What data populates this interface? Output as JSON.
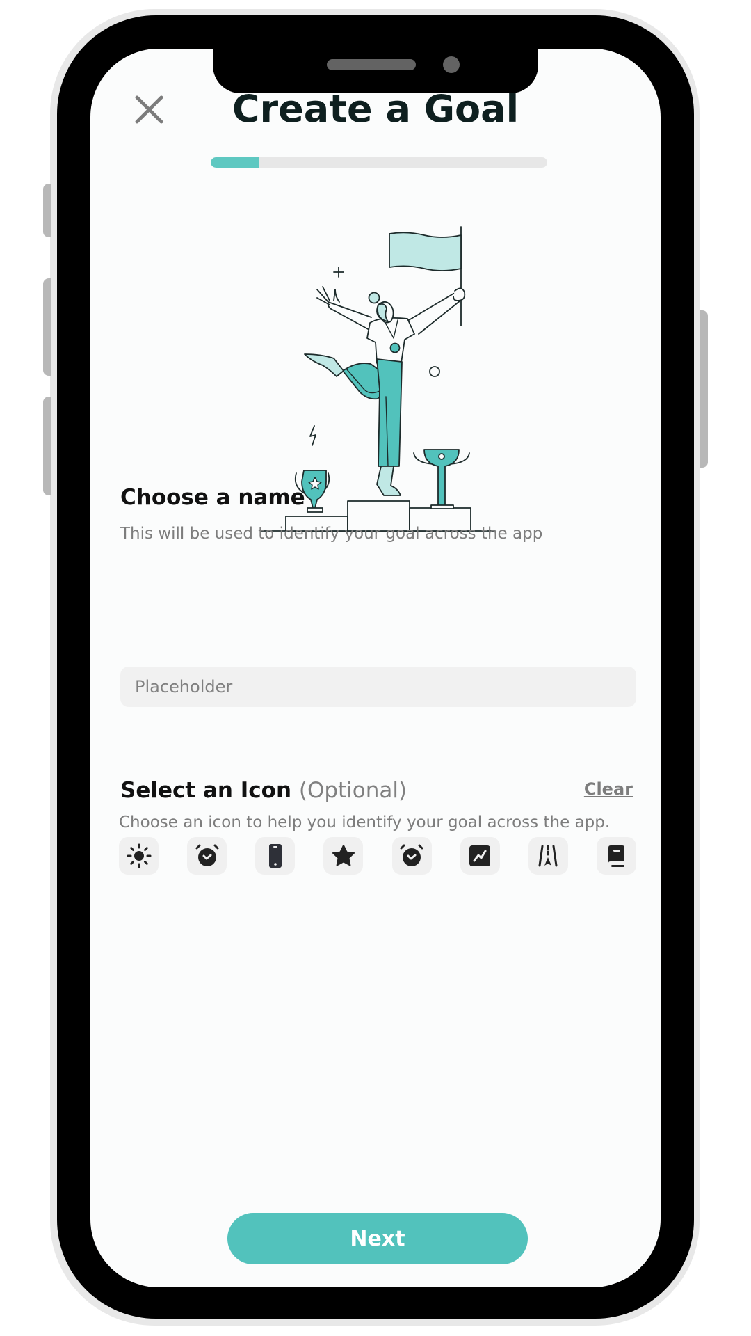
{
  "header": {
    "title": "Create a Goal",
    "close_icon": "close-icon",
    "progress": 0.145
  },
  "illustration": {
    "description": "woman-celebrating-on-podium-with-flag-and-trophies",
    "accent_color": "#52c2bc",
    "light_color": "#c0e8e5",
    "line_color": "#1d2b2b"
  },
  "name_section": {
    "title": "Choose a name",
    "subtitle": "This will be used to identify your goal across the app",
    "input_value": "",
    "input_placeholder": "Placeholder"
  },
  "icon_section": {
    "title": "Select an Icon",
    "optional_label": "(Optional)",
    "clear_label": "Clear",
    "subtitle": "Choose an icon to help you identify your goal across the app.",
    "icons": [
      {
        "name": "sun-icon"
      },
      {
        "name": "alarm-clock-icon"
      },
      {
        "name": "smartphone-icon"
      },
      {
        "name": "star-icon"
      },
      {
        "name": "alarm-clock-icon"
      },
      {
        "name": "trending-chart-icon"
      },
      {
        "name": "road-icon"
      },
      {
        "name": "book-icon"
      }
    ]
  },
  "footer": {
    "next_label": "Next"
  },
  "colors": {
    "accent": "#52c2bc",
    "progress_fill": "#5ec8c1",
    "progress_track": "#e7e7e7",
    "title": "#0e1f1f",
    "muted_text": "#7d7d7d",
    "input_bg": "#f1f1f1",
    "icon_tile_bg": "#f0f0f0",
    "icon_glyph": "#222222"
  }
}
